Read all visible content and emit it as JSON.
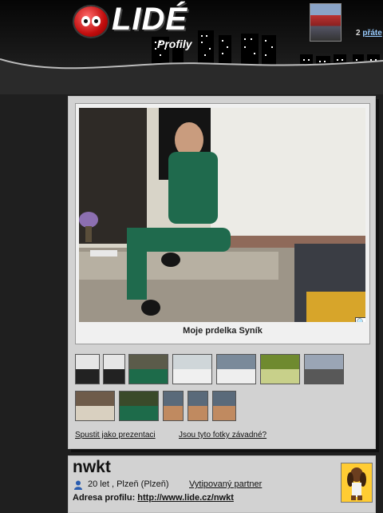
{
  "header": {
    "logo_text": "LIDÉ",
    "logo_subtitle": "Profily",
    "friends_count": "2",
    "friends_label": "přáte"
  },
  "photo": {
    "caption": "Moje prdelka Syník",
    "zoom_icon": "magnifier-icon"
  },
  "thumbnails": [
    {
      "name": "thumb-1",
      "colors": [
        "#e6e6e6",
        "#222"
      ]
    },
    {
      "name": "thumb-2",
      "colors": [
        "#e6e6e6",
        "#222"
      ]
    },
    {
      "name": "thumb-3",
      "colors": [
        "#5b5b4a",
        "#1d6b4a"
      ]
    },
    {
      "name": "thumb-4",
      "colors": [
        "#cfd6d9",
        "#f0f0f0"
      ]
    },
    {
      "name": "thumb-5",
      "colors": [
        "#7a8a9a",
        "#eeeeee"
      ]
    },
    {
      "name": "thumb-6",
      "colors": [
        "#6f8a2f",
        "#c8d08a"
      ]
    },
    {
      "name": "thumb-7",
      "colors": [
        "#9aa5b5",
        "#585858"
      ]
    },
    {
      "name": "thumb-8",
      "colors": [
        "#6e5b4a",
        "#d9d0c0"
      ]
    },
    {
      "name": "thumb-9",
      "colors": [
        "#3a4a2a",
        "#1d6b4a"
      ]
    },
    {
      "name": "thumb-10",
      "colors": [
        "#5a6a7a",
        "#c08a60"
      ]
    },
    {
      "name": "thumb-11",
      "colors": [
        "#5a6a7a",
        "#c08a60"
      ]
    },
    {
      "name": "thumb-12",
      "colors": [
        "#5a6a7a",
        "#c08a60"
      ]
    }
  ],
  "links": {
    "slideshow": "Spustit jako prezentaci",
    "report": "Jsou tyto fotky závadné?"
  },
  "profile": {
    "nickname": "nwkt",
    "age_location": "20 let , Plzeň (Plzeň)",
    "partner_link": "Vytipovaný partner",
    "address_label": "Adresa profilu:",
    "address_url": "http://www.lide.cz/nwkt"
  }
}
